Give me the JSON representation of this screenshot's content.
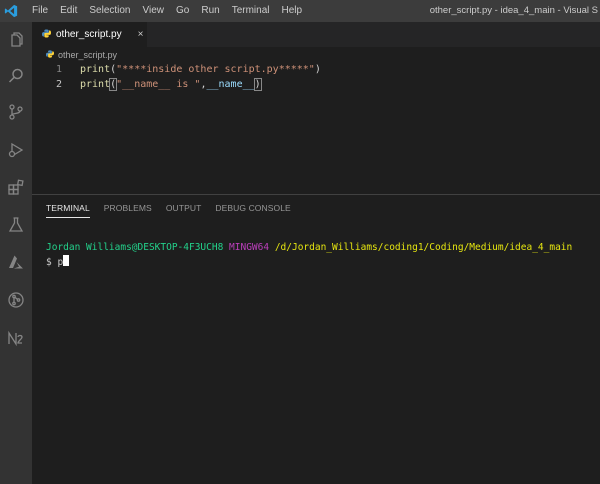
{
  "menu": [
    "File",
    "Edit",
    "Selection",
    "View",
    "Go",
    "Run",
    "Terminal",
    "Help"
  ],
  "window_title": "other_script.py - idea_4_main - Visual S",
  "activity_icons": [
    "explorer-icon",
    "search-icon",
    "source-control-icon",
    "run-debug-icon",
    "extensions-icon",
    "testing-flask-icon",
    "azure-icon",
    "git-graph-icon",
    "notebook-icon"
  ],
  "tab": {
    "label": "other_script.py",
    "close": "×"
  },
  "breadcrumb": "other_script.py",
  "editor": {
    "lines": [
      {
        "number": "1",
        "fn": "print",
        "open": "(",
        "str": "\"****inside other script.py*****\"",
        "close": ")"
      },
      {
        "number": "2",
        "fn": "print",
        "open": "(",
        "str": "\"__name__ is \"",
        "sep": ",",
        "var": "__name__",
        "close": ")"
      }
    ]
  },
  "panel": {
    "tabs": [
      "TERMINAL",
      "PROBLEMS",
      "OUTPUT",
      "DEBUG CONSOLE"
    ],
    "active_tab": "TERMINAL"
  },
  "terminal": {
    "user_host": "Jordan Williams@DESKTOP-4F3UCH8",
    "msys": "MINGW64",
    "path": "/d/Jordan_Williams/coding1/Coding/Medium/idea_4_main",
    "prompt": "$ p"
  },
  "colors": {
    "accent": "#007acc",
    "terminal_green": "#23d18b",
    "terminal_magenta": "#bc3fbc",
    "terminal_yellow": "#e5e510"
  }
}
